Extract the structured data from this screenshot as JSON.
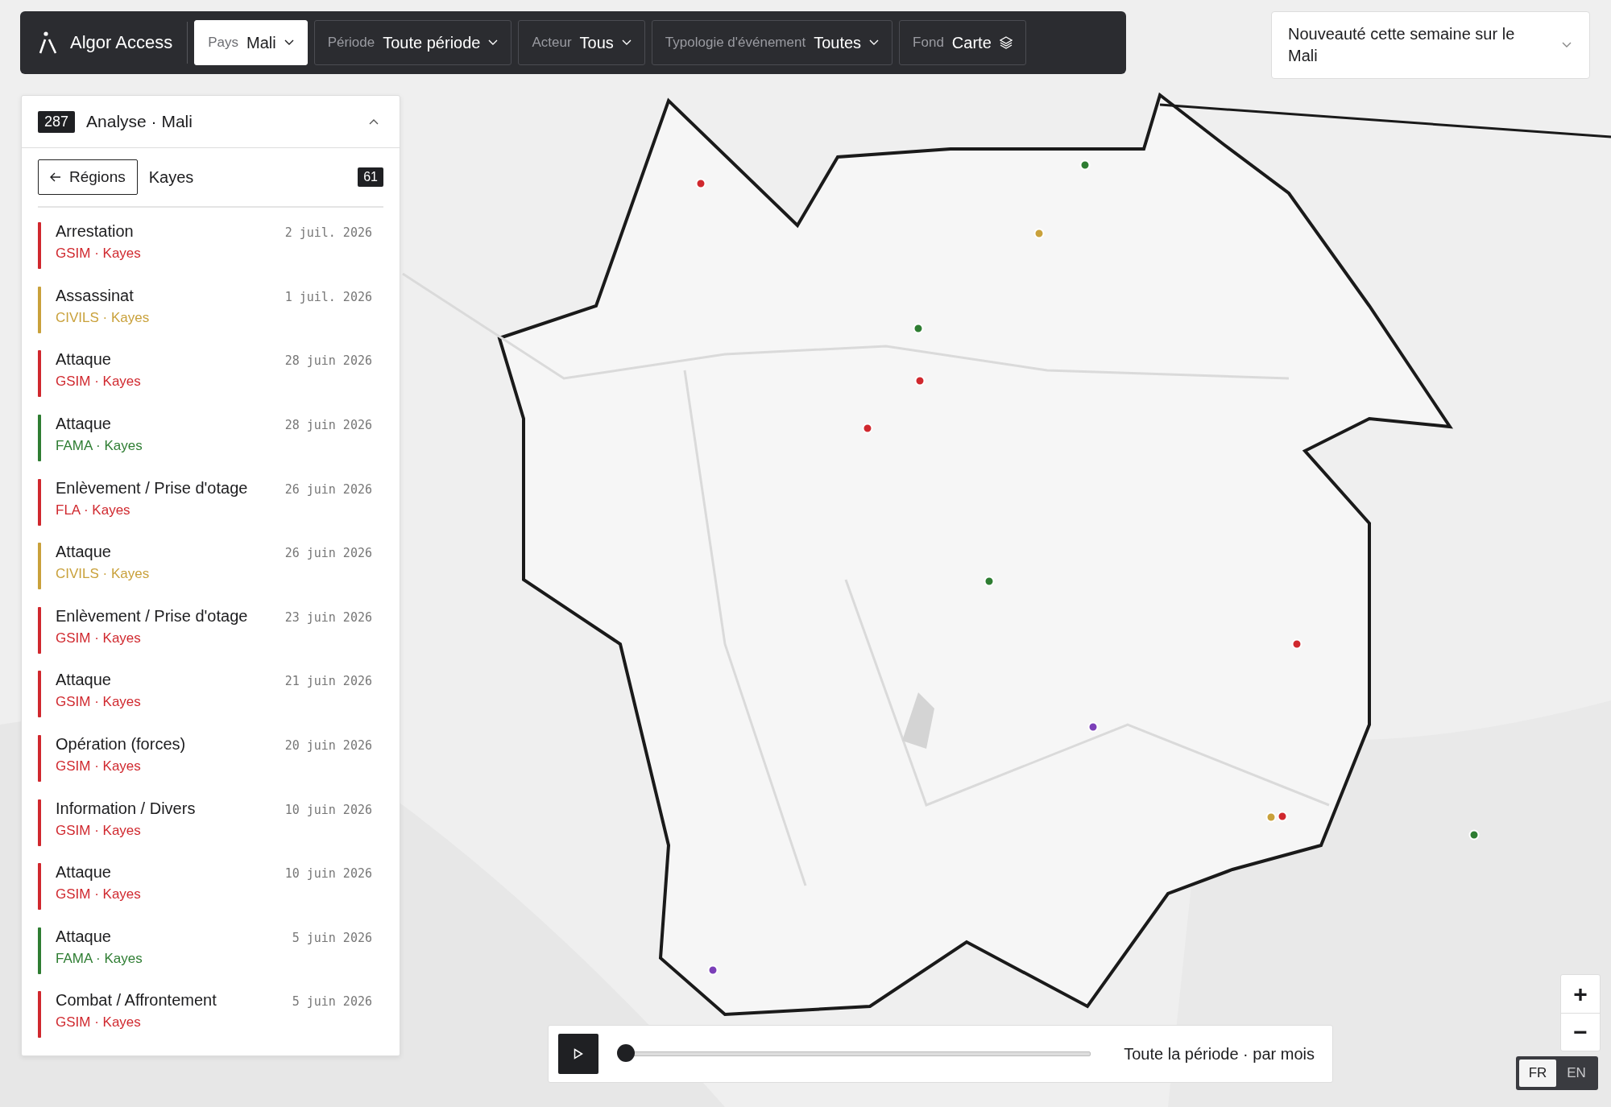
{
  "toolbar": {
    "brand": "Algor Access",
    "filters": [
      {
        "kind": "dropdown",
        "label": "Pays",
        "value": "Mali",
        "selected": true
      },
      {
        "kind": "dropdown",
        "label": "Période",
        "value": "Toute période",
        "selected": false
      },
      {
        "kind": "dropdown",
        "label": "Acteur",
        "value": "Tous",
        "selected": false
      },
      {
        "kind": "dropdown",
        "label": "Typologie d'événement",
        "value": "Toutes",
        "selected": false
      },
      {
        "kind": "layers",
        "label": "Fond",
        "value": "Carte",
        "selected": false
      }
    ]
  },
  "news": {
    "title": "Nouveauté cette semaine sur le Mali"
  },
  "panel": {
    "count": "287",
    "title": "Analyse · Mali",
    "expanded": true,
    "back_button": "Régions",
    "region": "Kayes",
    "region_count": "61",
    "events": [
      {
        "title": "Arrestation",
        "subtitle": "GSIM · Kayes",
        "date": "2 juil. 2026",
        "color": "#d0282e"
      },
      {
        "title": "Assassinat",
        "subtitle": "CIVILS · Kayes",
        "date": "1 juil. 2026",
        "color": "#c9a13b"
      },
      {
        "title": "Attaque",
        "subtitle": "GSIM · Kayes",
        "date": "28 juin 2026",
        "color": "#d0282e"
      },
      {
        "title": "Attaque",
        "subtitle": "FAMA · Kayes",
        "date": "28 juin 2026",
        "color": "#2e7d32"
      },
      {
        "title": "Enlèvement / Prise d'otage",
        "subtitle": "FLA · Kayes",
        "date": "26 juin 2026",
        "color": "#d0282e"
      },
      {
        "title": "Attaque",
        "subtitle": "CIVILS · Kayes",
        "date": "26 juin 2026",
        "color": "#c9a13b"
      },
      {
        "title": "Enlèvement / Prise d'otage",
        "subtitle": "GSIM · Kayes",
        "date": "23 juin 2026",
        "color": "#d0282e"
      },
      {
        "title": "Attaque",
        "subtitle": "GSIM · Kayes",
        "date": "21 juin 2026",
        "color": "#d0282e"
      },
      {
        "title": "Opération (forces)",
        "subtitle": "GSIM · Kayes",
        "date": "20 juin 2026",
        "color": "#d0282e"
      },
      {
        "title": "Information / Divers",
        "subtitle": "GSIM · Kayes",
        "date": "10 juin 2026",
        "color": "#d0282e"
      },
      {
        "title": "Attaque",
        "subtitle": "GSIM · Kayes",
        "date": "10 juin 2026",
        "color": "#d0282e"
      },
      {
        "title": "Attaque",
        "subtitle": "FAMA · Kayes",
        "date": "5 juin 2026",
        "color": "#2e7d32"
      },
      {
        "title": "Combat / Affrontement",
        "subtitle": "GSIM · Kayes",
        "date": "5 juin 2026",
        "color": "#d0282e"
      }
    ]
  },
  "timeline": {
    "level": 0,
    "caption": "Toute la période · par mois"
  },
  "zoom_controls": {
    "zoom_in": "+",
    "zoom_out": "−"
  },
  "languages": [
    {
      "label": "FR",
      "selected": true
    },
    {
      "label": "EN",
      "selected": false
    }
  ]
}
